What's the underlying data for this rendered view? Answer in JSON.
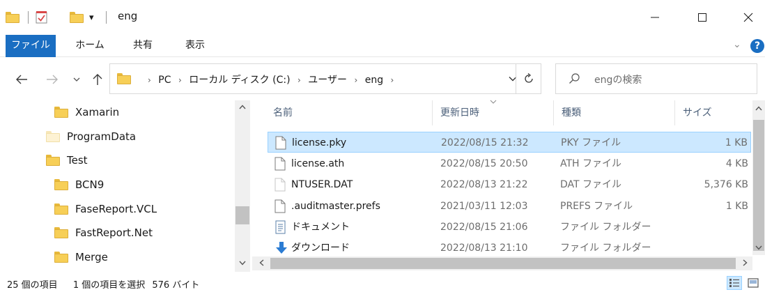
{
  "window": {
    "title": "eng",
    "minimize_glyph": "—",
    "maximize_glyph": "☐",
    "close_glyph": "✕"
  },
  "quick_access": {
    "dropdown_glyph": "▾"
  },
  "ribbon": {
    "tabs": [
      {
        "label": "ファイル",
        "active": true
      },
      {
        "label": "ホーム",
        "active": false
      },
      {
        "label": "共有",
        "active": false
      },
      {
        "label": "表示",
        "active": false
      }
    ],
    "expand_glyph": "⌄",
    "help_glyph": "?"
  },
  "address": {
    "crumbs": [
      "PC",
      "ローカル ディスク (C:)",
      "ユーザー",
      "eng"
    ],
    "separator": "›",
    "dropdown_glyph": "⌄"
  },
  "search": {
    "placeholder": "engの検索"
  },
  "nav_tree": [
    {
      "label": "Xamarin",
      "pale": false,
      "indent": 1
    },
    {
      "label": "ProgramData",
      "pale": true,
      "indent": 0
    },
    {
      "label": "Test",
      "pale": false,
      "indent": 0
    },
    {
      "label": "BCN9",
      "pale": false,
      "indent": 1
    },
    {
      "label": "FaseReport.VCL",
      "pale": false,
      "indent": 1
    },
    {
      "label": "FastReport.Net",
      "pale": false,
      "indent": 1
    },
    {
      "label": "Merge",
      "pale": false,
      "indent": 1
    }
  ],
  "columns": {
    "name": "名前",
    "date": "更新日時",
    "type": "種類",
    "size": "サイズ"
  },
  "files": [
    {
      "name": "license.pky",
      "date": "2022/08/15 21:32",
      "type": "PKY ファイル",
      "size": "1 KB",
      "icon": "file",
      "selected": true
    },
    {
      "name": "license.ath",
      "date": "2022/08/15 20:50",
      "type": "ATH ファイル",
      "size": "4 KB",
      "icon": "file",
      "selected": false
    },
    {
      "name": "NTUSER.DAT",
      "date": "2022/08/13 21:22",
      "type": "DAT ファイル",
      "size": "5,376 KB",
      "icon": "file-pale",
      "selected": false
    },
    {
      "name": ".auditmaster.prefs",
      "date": "2021/03/11 12:03",
      "type": "PREFS ファイル",
      "size": "1 KB",
      "icon": "file",
      "selected": false
    },
    {
      "name": "ドキュメント",
      "date": "2022/08/15 21:06",
      "type": "ファイル フォルダー",
      "size": "",
      "icon": "document",
      "selected": false
    },
    {
      "name": "ダウンロード",
      "date": "2022/08/13 21:10",
      "type": "ファイル フォルダー",
      "size": "",
      "icon": "download",
      "selected": false
    }
  ],
  "status": {
    "item_count": "25 個の項目",
    "selection": "1 個の項目を選択",
    "selection_size": "576 バイト"
  },
  "colors": {
    "accent": "#1a6ec2",
    "selection_bg": "#cce8ff",
    "selection_border": "#99d1ff",
    "folder": "#f7cf57",
    "header_text": "#4c607a"
  }
}
